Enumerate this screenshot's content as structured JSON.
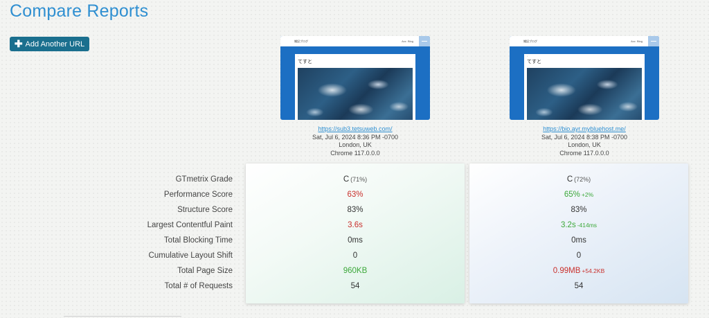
{
  "page": {
    "title": "Compare Reports",
    "add_button": "Add Another URL"
  },
  "colors": {
    "accent": "#2f8fd1",
    "button": "#1a6f8e",
    "bad": "#c9302c",
    "good": "#3ca83a"
  },
  "metric_labels": [
    "GTmetrix Grade",
    "Performance Score",
    "Structure Score",
    "Largest Contentful Paint",
    "Total Blocking Time",
    "Cumulative Layout Shift",
    "Total Page Size",
    "Total # of Requests"
  ],
  "reports": [
    {
      "thumb": {
        "site_name": "雑記ブログ",
        "nav1": "Acc",
        "nav2": "Blog",
        "post_title": "てすと"
      },
      "url": "https://sub3.tetsuweb.com/",
      "date": "Sat, Jul 6, 2024 8:36 PM -0700",
      "location": "London, UK",
      "browser": "Chrome 117.0.0.0",
      "grade": "C",
      "grade_pct": "(71%)",
      "performance": "63%",
      "performance_delta": "",
      "structure": "83%",
      "lcp": "3.6s",
      "lcp_delta": "",
      "tbt": "0ms",
      "cls": "0",
      "page_size": "960KB",
      "page_size_delta": "",
      "requests": "54"
    },
    {
      "thumb": {
        "site_name": "雑記ブログ",
        "nav1": "Acc",
        "nav2": "Blog",
        "post_title": "てすと"
      },
      "url": "https://bio.ayr.mybluehost.me/",
      "date": "Sat, Jul 6, 2024 8:38 PM -0700",
      "location": "London, UK",
      "browser": "Chrome 117.0.0.0",
      "grade": "C",
      "grade_pct": "(72%)",
      "performance": "65%",
      "performance_delta": "+2%",
      "structure": "83%",
      "lcp": "3.2s",
      "lcp_delta": "-414ms",
      "tbt": "0ms",
      "cls": "0",
      "page_size": "0.99MB",
      "page_size_delta": "+54.2KB",
      "requests": "54"
    }
  ]
}
